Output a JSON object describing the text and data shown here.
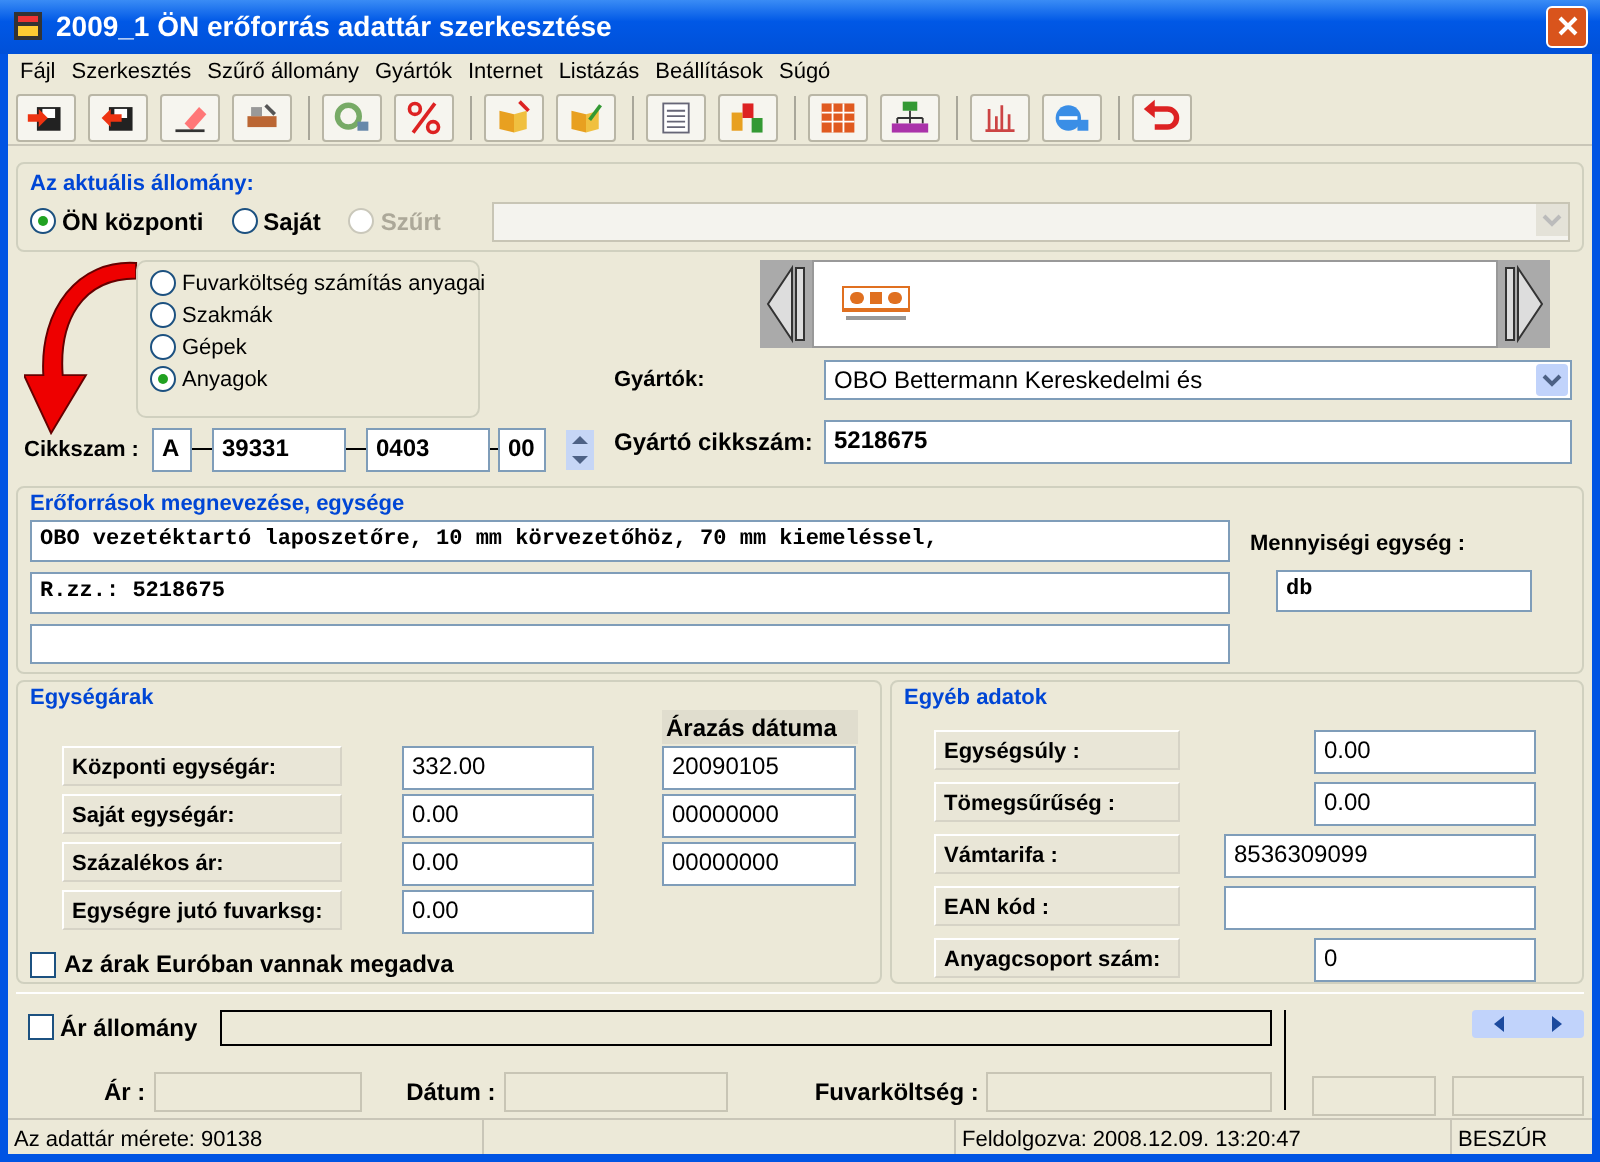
{
  "window": {
    "title": "2009_1 ÖN erőforrás adattár szerkesztése"
  },
  "menu": [
    "Fájl",
    "Szerkesztés",
    "Szűrő állomány",
    "Gyártók",
    "Internet",
    "Listázás",
    "Beállítások",
    "Súgó"
  ],
  "current_file": {
    "title": "Az aktuális állomány:",
    "options": [
      {
        "label": "ÖN központi",
        "selected": true,
        "disabled": false
      },
      {
        "label": "Saját",
        "selected": false,
        "disabled": false
      },
      {
        "label": "Szűrt",
        "selected": false,
        "disabled": true
      }
    ]
  },
  "resource_types": [
    {
      "label": "Fuvarköltség számítás anyagai",
      "selected": false
    },
    {
      "label": "Szakmák",
      "selected": false
    },
    {
      "label": "Gépek",
      "selected": false
    },
    {
      "label": "Anyagok",
      "selected": true
    }
  ],
  "manufacturer": {
    "label": "Gyártók:",
    "value": "OBO Bettermann Kereskedelmi és"
  },
  "item_code": {
    "label": "Cikkszam :",
    "parts": [
      "A",
      "39331",
      "0403",
      "00"
    ]
  },
  "manufacturer_code": {
    "label": "Gyártó cikkszám:",
    "value": "5218675"
  },
  "names": {
    "title": "Erőforrások megnevezése, egysége",
    "lines": [
      "OBO vezetéktartó laposzetőre, 10 mm körvezetőhöz, 70 mm kiemeléssel,",
      "R.zz.: 5218675"
    ],
    "unit_label": "Mennyiségi egység :",
    "unit": "db"
  },
  "prices": {
    "title": "Egységárak",
    "date_header": "Árazás dátuma",
    "rows": [
      {
        "label": "Központi egységár:",
        "value": "332.00",
        "date": "20090105"
      },
      {
        "label": "Saját egységár:",
        "value": "0.00",
        "date": "00000000"
      },
      {
        "label": "Százalékos ár:",
        "value": "0.00",
        "date": "00000000"
      },
      {
        "label": "Egységre jutó fuvarksg:",
        "value": "0.00"
      }
    ],
    "euro": {
      "label": "Az árak Euróban vannak megadva",
      "checked": false
    }
  },
  "other": {
    "title": "Egyéb adatok",
    "rows": [
      {
        "label": "Egységsúly :",
        "value": "0.00",
        "kind": "short"
      },
      {
        "label": "Tömegsűrűség :",
        "value": "0.00",
        "kind": "short"
      },
      {
        "label": "Vámtarifa :",
        "value": "8536309099",
        "kind": "long"
      },
      {
        "label": "EAN kód :",
        "kind": "long"
      },
      {
        "label": "Anyagcsoport szám:",
        "value": "0",
        "kind": "short"
      }
    ]
  },
  "price_file": {
    "label": "Ár állomány",
    "checked": false,
    "fields": [
      "Ár :",
      "Dátum :",
      "Fuvarköltség :"
    ]
  },
  "status_bar": {
    "size": "Az adattár mérete: 90138",
    "processed": "Feldolgozva: 2008.12.09. 13:20:47",
    "mode": "BESZÚR"
  }
}
